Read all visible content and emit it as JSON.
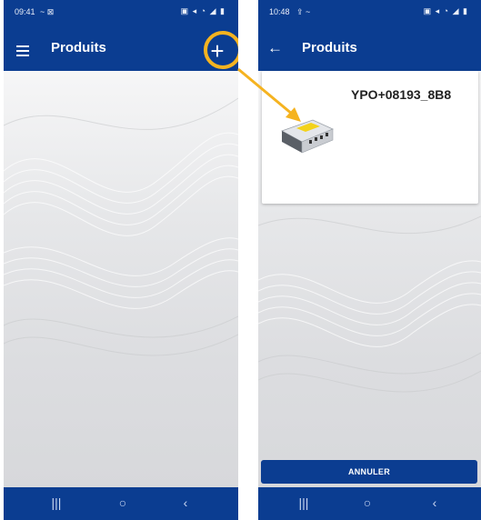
{
  "colors": {
    "primary": "#0b3d91",
    "highlight": "#f5b320",
    "background": "#f4f5f7"
  },
  "left_screen": {
    "status_time": "09:41",
    "status_extra": "~ ⊠",
    "status_icons": "▣ ◂ ◔ ◢ ▮",
    "app_title": "Produits",
    "menu_icon": "hamburger-menu-icon",
    "add_icon": "plus-icon",
    "add_symbol": "+",
    "nav": {
      "recent_symbol": "|||",
      "home_symbol": "○",
      "back_symbol": "‹"
    }
  },
  "right_screen": {
    "status_time": "10:48",
    "status_extra": "⇪ ~",
    "status_icons": "▣ ◂ ◔ ◢ ▮",
    "app_title": "Produits",
    "back_icon": "arrow-left-icon",
    "back_symbol": "←",
    "product": {
      "name": "YPO+08193_8B8",
      "image": "controller-module-image"
    },
    "cancel_label": "ANNULER",
    "nav": {
      "recent_symbol": "|||",
      "home_symbol": "○",
      "back_symbol": "‹"
    }
  }
}
